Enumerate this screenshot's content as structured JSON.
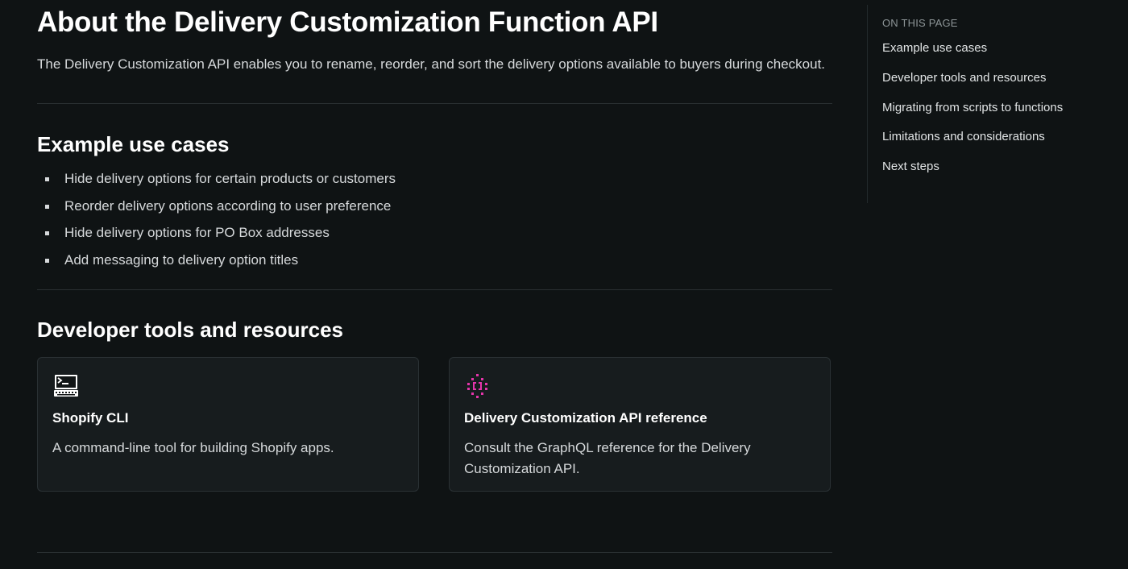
{
  "main": {
    "title": "About the Delivery Customization Function API",
    "lead": "The Delivery Customization API enables you to rename, reorder, and sort the delivery options available to buyers during checkout.",
    "use_cases": {
      "heading": "Example use cases",
      "items": [
        "Hide delivery options for certain products or customers",
        "Reorder delivery options according to user preference",
        "Hide delivery options for PO Box addresses",
        "Add messaging to delivery option titles"
      ]
    },
    "dev_tools": {
      "heading": "Developer tools and resources",
      "cards": [
        {
          "icon": "terminal-icon",
          "title": "Shopify CLI",
          "description": "A command-line tool for building Shopify apps."
        },
        {
          "icon": "graphql-icon",
          "title": "Delivery Customization API reference",
          "description": "Consult the GraphQL reference for the Delivery Customization API."
        }
      ]
    }
  },
  "toc": {
    "title": "ON THIS PAGE",
    "items": [
      "Example use cases",
      "Developer tools and resources",
      "Migrating from scripts to functions",
      "Limitations and considerations",
      "Next steps"
    ]
  },
  "colors": {
    "background": "#0f1314",
    "card_background": "#171c1e",
    "graphql_icon_accent": "#e535ab"
  }
}
